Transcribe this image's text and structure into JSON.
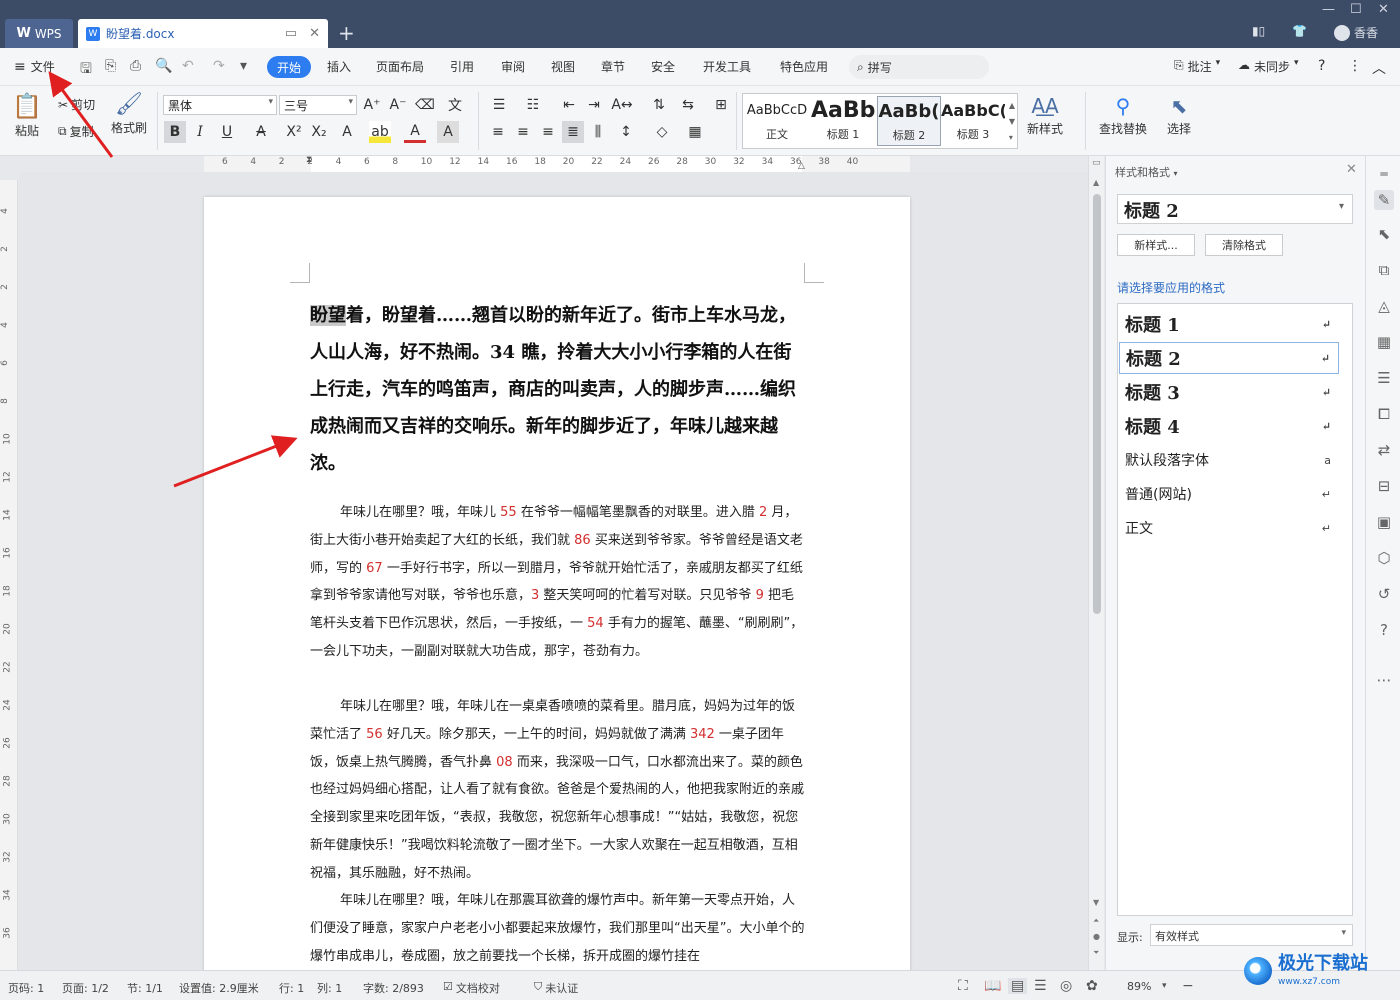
{
  "titlebar": {
    "wps_label": "WPS",
    "doc_tab": "盼望着.docx",
    "user": "香香"
  },
  "menubar": {
    "file": "文件",
    "tabs": [
      "开始",
      "插入",
      "页面布局",
      "引用",
      "审阅",
      "视图",
      "章节",
      "安全",
      "开发工具",
      "特色应用"
    ],
    "search": "拼写",
    "comment": "批注",
    "sync": "未同步"
  },
  "ribbon": {
    "paste": "粘贴",
    "cut": "剪切",
    "copy": "复制",
    "format_painter": "格式刷",
    "font": "黑体",
    "size": "三号",
    "styles": [
      {
        "sample": "AaBbCcD",
        "name": "正文"
      },
      {
        "sample": "AaBb",
        "name": "标题 1"
      },
      {
        "sample": "AaBb(",
        "name": "标题 2"
      },
      {
        "sample": "AaBbC(",
        "name": "标题 3"
      }
    ],
    "new_style": "新样式",
    "find_replace": "查找替换",
    "select": "选择"
  },
  "ruler": {
    "h_numbers": [
      "6",
      "4",
      "2",
      "2",
      "4",
      "6",
      "8",
      "10",
      "12",
      "14",
      "16",
      "18",
      "20",
      "22",
      "24",
      "26",
      "28",
      "30",
      "32",
      "34",
      "36",
      "38",
      "40"
    ],
    "v_numbers": [
      "4",
      "2",
      "2",
      "4",
      "6",
      "8",
      "10",
      "12",
      "14",
      "16",
      "18",
      "20",
      "22",
      "24",
      "26",
      "28",
      "30",
      "32",
      "34",
      "36"
    ]
  },
  "document": {
    "heading": {
      "highlight": "盼望",
      "rest": "着，盼望着……翘首以盼的新年近了。街市上车水马龙，人山人海，好不热闹。34 瞧，拎着大大小小行李箱的人在街上行走，汽车的鸣笛声，商店的叫卖声，人的脚步声……编织成热闹而又吉祥的交响乐。新年的脚步近了，年味儿越来越浓。"
    },
    "paragraphs": [
      [
        {
          "t": "年味儿在哪里？哦，年味儿 "
        },
        {
          "t": "55",
          "red": true
        },
        {
          "t": " 在爷爷一幅幅笔墨飘香的对联里。进入腊 "
        },
        {
          "t": "2",
          "red": true
        },
        {
          "t": " 月，街上大街小巷开始卖起了大红的长纸，我们就 "
        },
        {
          "t": "86",
          "red": true
        },
        {
          "t": " 买来送到爷爷家。爷爷曾经是语文老师，写的 "
        },
        {
          "t": "67",
          "red": true
        },
        {
          "t": " 一手好行书字，所以一到腊月，爷爷就开始忙活了，亲戚朋友都买了红纸拿到爷爷家请他写对联，爷爷也乐意，"
        },
        {
          "t": "3",
          "red": true
        },
        {
          "t": " 整天笑呵呵的忙着写对联。只见爷爷 "
        },
        {
          "t": "9",
          "red": true
        },
        {
          "t": " 把毛笔杆头支着下巴作沉思状，然后，一手按纸，一 "
        },
        {
          "t": "54",
          "red": true
        },
        {
          "t": " 手有力的握笔、蘸墨、“刷刷刷”，一会儿下功夫，一副副对联就大功告成，那字，苍劲有力。"
        }
      ],
      [
        {
          "t": "年味儿在哪里？哦，年味儿在一桌桌香喷喷的菜肴里。腊月底，妈妈为过年的饭菜忙活了 "
        },
        {
          "t": "56",
          "red": true
        },
        {
          "t": " 好几天。除夕那天，一上午的时间，妈妈就做了满满 "
        },
        {
          "t": "342",
          "red": true
        },
        {
          "t": " 一桌子团年饭，饭桌上热气腾腾，香气扑鼻 "
        },
        {
          "t": "08",
          "red": true
        },
        {
          "t": " 而来，我深吸一口气，口水都流出来了。菜的颜色也经过妈妈细心搭配，让人看了就有食欲。爸爸是个爱热闹的人，他把我家附近的亲戚全接到家里来吃团年饭，“表叔，我敬您，祝您新年心想事成！”“姑姑，我敬您，祝您新年健康快乐！”我喝饮料轮流敬了一圈才坐下。一大家人欢聚在一起互相敬酒，互相祝福，其乐融融，好不热闹。"
        }
      ],
      [
        {
          "t": "年味儿在哪里？哦，年味儿在那震耳欲聋的爆竹声中。新年第一天零点开始，人们便没了睡意，家家户户老老小小都要起来放爆竹，我们那里叫“出天星”。大小单个的爆竹串成串儿，卷成圈，放之前要找一个长梯，拆开成圈的爆竹挂在"
        }
      ]
    ]
  },
  "style_panel": {
    "title": "样式和格式",
    "current": "标题  2",
    "new_style_btn": "新样式...",
    "clear_btn": "清除格式",
    "prompt": "请选择要应用的格式",
    "items": [
      {
        "label": "标题  1",
        "mark": "↵",
        "kind": "h"
      },
      {
        "label": "标题  2",
        "mark": "↵",
        "kind": "h",
        "active": true
      },
      {
        "label": "标题  3",
        "mark": "↵",
        "kind": "h"
      },
      {
        "label": "标题  4",
        "mark": "↵",
        "kind": "h"
      },
      {
        "label": "默认段落字体",
        "mark": "a",
        "kind": "n"
      },
      {
        "label": "普通(网站)",
        "mark": "↵",
        "kind": "n"
      },
      {
        "label": "正文",
        "mark": "↵",
        "kind": "n"
      }
    ],
    "show_label": "显示:",
    "show_value": "有效样式"
  },
  "statusbar": {
    "page_num": "页码: 1",
    "page": "页面: 1/2",
    "section": "节: 1/1",
    "setting": "设置值: 2.9厘米",
    "row": "行: 1",
    "col": "列: 1",
    "words": "字数: 2/893",
    "proof": "文档校对",
    "cert": "未认证",
    "zoom": "89%"
  },
  "watermark": {
    "text": "极光下载站",
    "url": "www.xz7.com"
  },
  "colors": {
    "accent": "#2d7cf0",
    "titlebar": "#3d4c66",
    "annotation_arrow": "#e02020",
    "red_digits": "#d32f2f"
  }
}
